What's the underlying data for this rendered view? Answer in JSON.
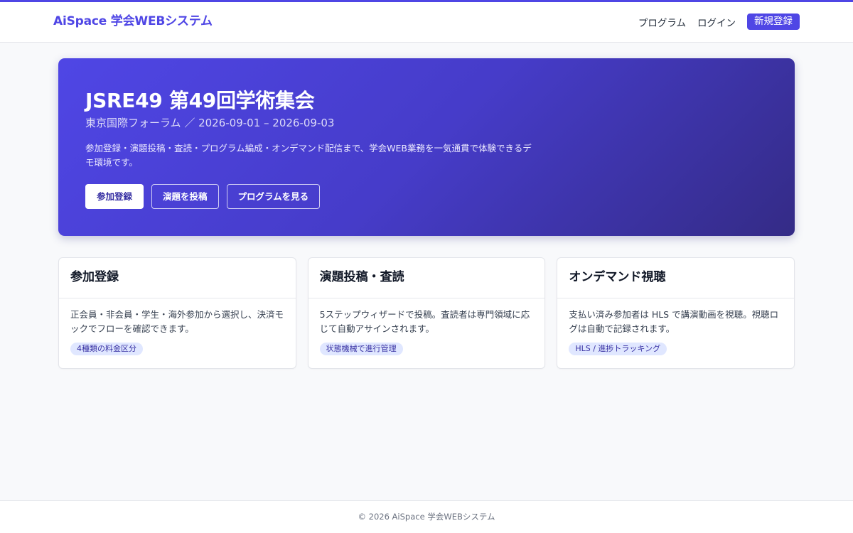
{
  "header": {
    "brand": "AiSpace 学会WEBシステム",
    "nav": {
      "program": "プログラム",
      "login": "ログイン",
      "signup": "新規登録"
    }
  },
  "hero": {
    "title": "JSRE49 第49回学術集会",
    "subtitle": "東京国際フォーラム ／ 2026-09-01 – 2026-09-03",
    "description": "参加登録・演題投稿・査読・プログラム編成・オンデマンド配信まで、学会WEB業務を一気通貫で体験できるデモ環境です。",
    "actions": {
      "register": "参加登録",
      "submit": "演題を投稿",
      "program": "プログラムを見る"
    }
  },
  "cards": [
    {
      "title": "参加登録",
      "text": "正会員・非会員・学生・海外参加から選択し、決済モックでフローを確認できます。",
      "tag": "4種類の料金区分"
    },
    {
      "title": "演題投稿・査読",
      "text": "5ステップウィザードで投稿。査読者は専門領域に応じて自動アサインされます。",
      "tag": "状態機械で進行管理"
    },
    {
      "title": "オンデマンド視聴",
      "text": "支払い済み参加者は HLS で講演動画を視聴。視聴ログは自動で記録されます。",
      "tag": "HLS / 進捗トラッキング"
    }
  ],
  "footer": {
    "text": "© 2026 AiSpace 学会WEBシステム"
  },
  "colors": {
    "accent": "#4f46e5",
    "hero_dark": "#342b86",
    "tag_bg": "#e0e7ff"
  }
}
